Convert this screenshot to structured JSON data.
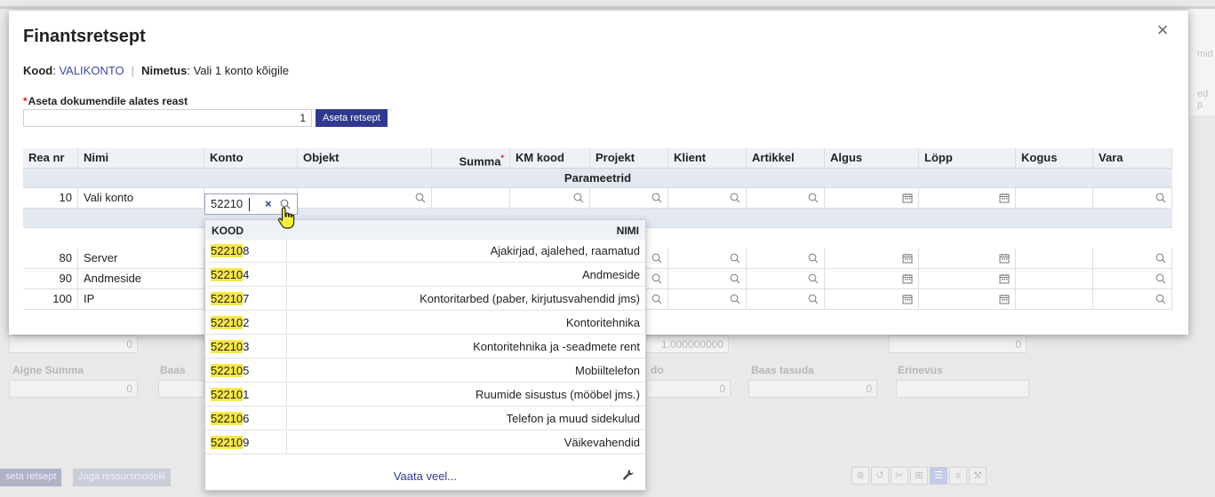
{
  "background": {
    "right_text_1": "mid",
    "right_text_2": "ed p",
    "labels": {
      "algne_summa": "Algne Summa",
      "baas": "Baas",
      "do": "do",
      "baas_tasuda": "Baas tasuda",
      "erinevus": "Erinevus"
    },
    "fields": {
      "f1": "0",
      "f2": "0",
      "f3": "1.000000000",
      "f4": "0",
      "f5": "0",
      "f6": "0",
      "f7": "0"
    },
    "buttons": {
      "aseta": "seta retsept",
      "jaga": "Jaga ressursmodelil"
    }
  },
  "modal": {
    "title": "Finantsretsept",
    "close_label": "×",
    "info": {
      "kood_label": "Kood",
      "kood_value": "VALIKONTO",
      "separator": "|",
      "nimetus_label": "Nimetus",
      "nimetus_value": "Vali 1 konto kõigile"
    },
    "row_field": {
      "required_mark": "*",
      "label": "Aseta dokumendile alates reast",
      "value": "1",
      "button": "Aseta retsept"
    },
    "table": {
      "columns": [
        "Rea nr",
        "Nimi",
        "Konto",
        "Objekt",
        "Summa",
        "KM kood",
        "Projekt",
        "Klient",
        "Artikkel",
        "Algus",
        "Löpp",
        "Kogus",
        "Vara"
      ],
      "required_mark": "*",
      "group_label": "Parameetrid",
      "rows": [
        {
          "nr": "10",
          "nimi": "Vali konto"
        },
        {
          "nr": "80",
          "nimi": "Server"
        },
        {
          "nr": "90",
          "nimi": "Andmeside"
        },
        {
          "nr": "100",
          "nimi": "IP"
        }
      ]
    },
    "konto_input": {
      "value": "52210",
      "clear_label": "×"
    }
  },
  "dropdown": {
    "col_kood": "KOOD",
    "col_nimi": "NIMI",
    "query": "52210",
    "items": [
      {
        "prefix": "52210",
        "suffix": "8",
        "nimi": "Ajakirjad, ajalehed, raamatud"
      },
      {
        "prefix": "52210",
        "suffix": "4",
        "nimi": "Andmeside"
      },
      {
        "prefix": "52210",
        "suffix": "7",
        "nimi": "Kontoritarbed (paber, kirjutusvahendid jms)"
      },
      {
        "prefix": "52210",
        "suffix": "2",
        "nimi": "Kontoritehnika"
      },
      {
        "prefix": "52210",
        "suffix": "3",
        "nimi": "Kontoritehnika ja -seadmete rent"
      },
      {
        "prefix": "52210",
        "suffix": "5",
        "nimi": "Mobiiltelefon"
      },
      {
        "prefix": "52210",
        "suffix": "1",
        "nimi": "Ruumide sisustus (mööbel jms.)"
      },
      {
        "prefix": "52210",
        "suffix": "6",
        "nimi": "Telefon ja muud sidekulud"
      },
      {
        "prefix": "52210",
        "suffix": "9",
        "nimi": "Väikevahendid"
      }
    ],
    "more_label": "Vaata veel..."
  },
  "colors": {
    "accent": "#2f3a8f",
    "highlight": "#f6e84a",
    "header_bg": "#eef1f6",
    "required": "#dd2222"
  }
}
